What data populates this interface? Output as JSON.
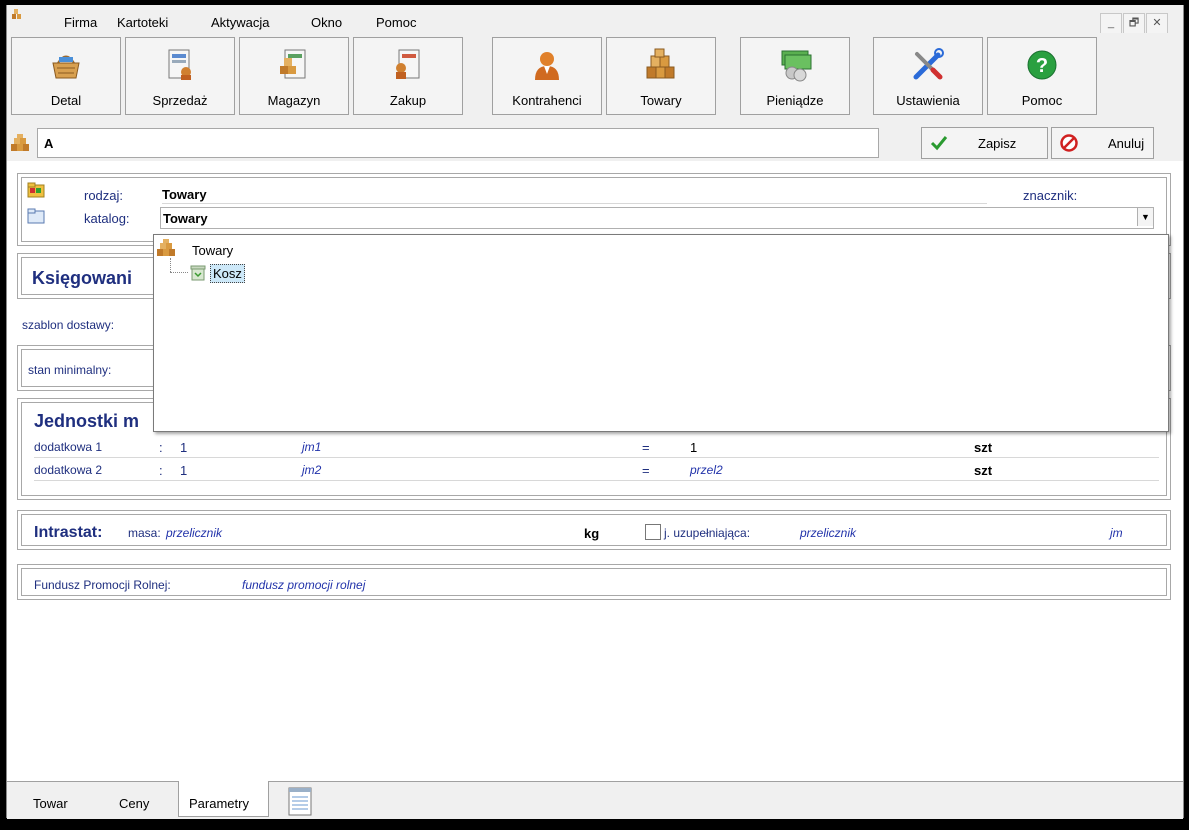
{
  "menu": {
    "items": [
      "Firma",
      "Kartoteki",
      "Aktywacja",
      "Okno",
      "Pomoc"
    ]
  },
  "window_controls": {
    "minimize": "_",
    "restore": "🗗",
    "close": "✕"
  },
  "toolbar": {
    "buttons": [
      {
        "label": "Detal",
        "icon": "shopping-basket-icon"
      },
      {
        "label": "Sprzedaż",
        "icon": "sales-document-icon"
      },
      {
        "label": "Magazyn",
        "icon": "warehouse-document-icon"
      },
      {
        "label": "Zakup",
        "icon": "purchase-document-icon"
      },
      {
        "label": "Kontrahenci",
        "icon": "person-icon"
      },
      {
        "label": "Towary",
        "icon": "boxes-icon"
      },
      {
        "label": "Pieniądze",
        "icon": "money-icon"
      },
      {
        "label": "Ustawienia",
        "icon": "tools-icon"
      },
      {
        "label": "Pomoc",
        "icon": "help-icon"
      }
    ]
  },
  "name_field": {
    "value": "A"
  },
  "actions": {
    "save_label": "Zapisz",
    "cancel_label": "Anuluj"
  },
  "type_panel": {
    "rodzaj_label": "rodzaj:",
    "rodzaj_value": "Towary",
    "katalog_label": "katalog:",
    "katalog_value": "Towary",
    "znacznik_label": "znacznik:"
  },
  "dropdown": {
    "root": "Towary",
    "child": "Kosz"
  },
  "accounting": {
    "heading": "Księgowani"
  },
  "delivery": {
    "label": "szablon dostawy:"
  },
  "stock": {
    "label": "stan minimalny:"
  },
  "units": {
    "heading": "Jednostki m",
    "rows": [
      {
        "label": "dodatkowa 1",
        "sep": ":",
        "qty": "1",
        "unit": "jm1",
        "eq": "=",
        "factor": "1",
        "base": "szt"
      },
      {
        "label": "dodatkowa 2",
        "sep": ":",
        "qty": "1",
        "unit": "jm2",
        "eq": "=",
        "factor": "przel2",
        "base": "szt"
      }
    ]
  },
  "intrastat": {
    "heading": "Intrastat:",
    "masa_label": "masa:",
    "masa_value": "przelicznik",
    "kg": "kg",
    "supp_label": "j. uzupełniająca:",
    "supp_value": "przelicznik",
    "jm": "jm"
  },
  "fund": {
    "label": "Fundusz Promocji Rolnej:",
    "value": "fundusz promocji rolnej"
  },
  "tabs": [
    "Towar",
    "Ceny",
    "Parametry"
  ]
}
